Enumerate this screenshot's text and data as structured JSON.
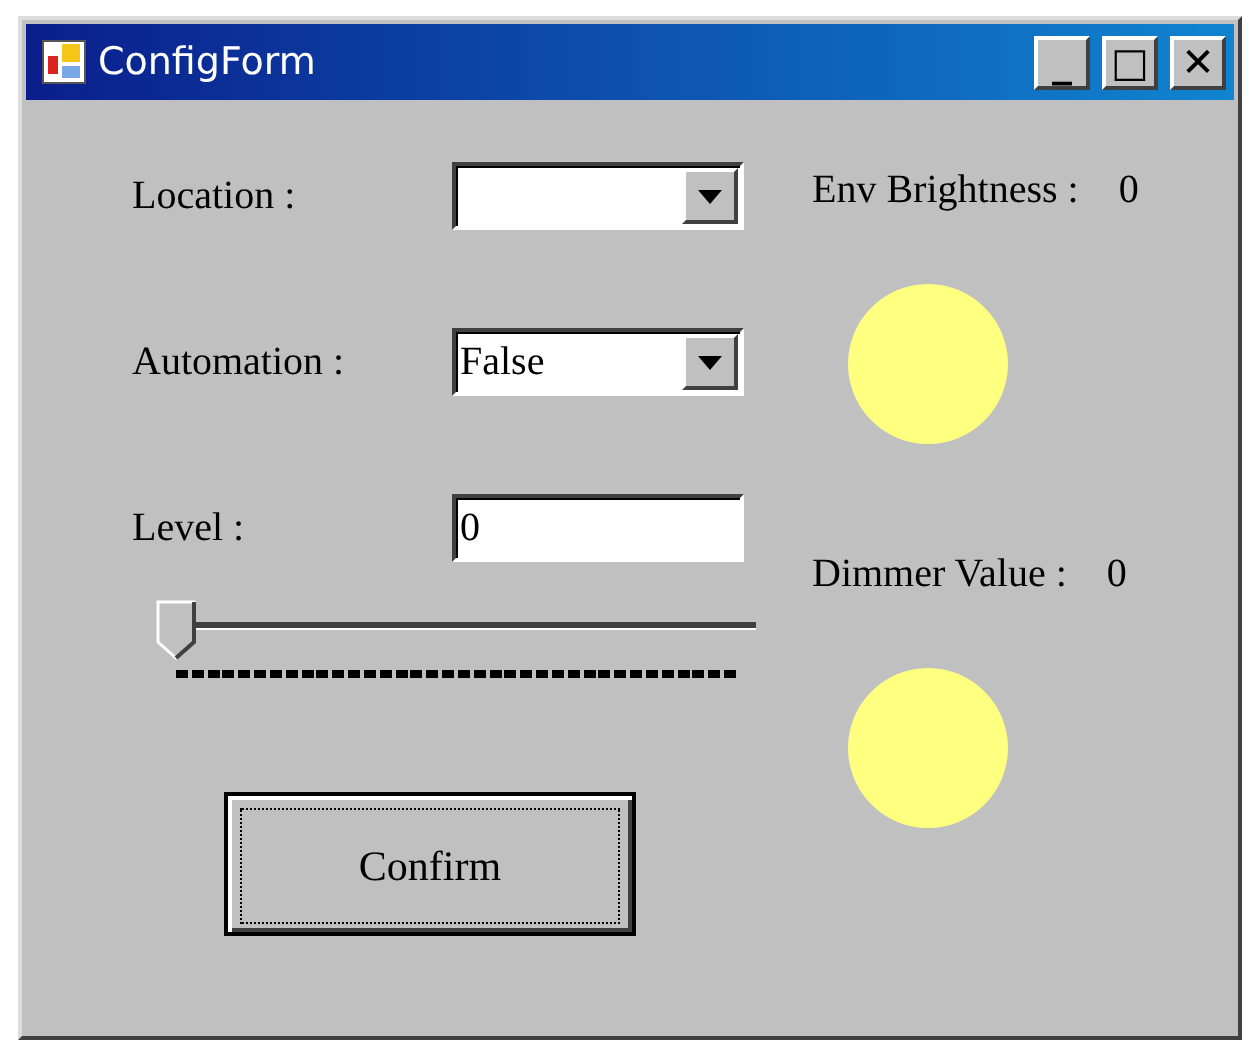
{
  "window": {
    "title": "ConfigForm",
    "buttons": [
      "_",
      "□",
      "✕"
    ]
  },
  "fields": [
    {
      "label": "Location :",
      "kind": "dropdown"
    },
    {
      "label": "Automation :",
      "kind": "dropdown",
      "value": "False"
    },
    {
      "label": "Level :",
      "kind": "text",
      "value": "0"
    }
  ],
  "slider": {
    "level": 0
  },
  "confirm": "Confirm",
  "indicators": [
    {
      "label": "Env Brightness :",
      "value": "0",
      "color": "#ffff80"
    },
    {
      "label": "Dimmer Value :",
      "value": "0",
      "color": "#ffff80"
    }
  ]
}
